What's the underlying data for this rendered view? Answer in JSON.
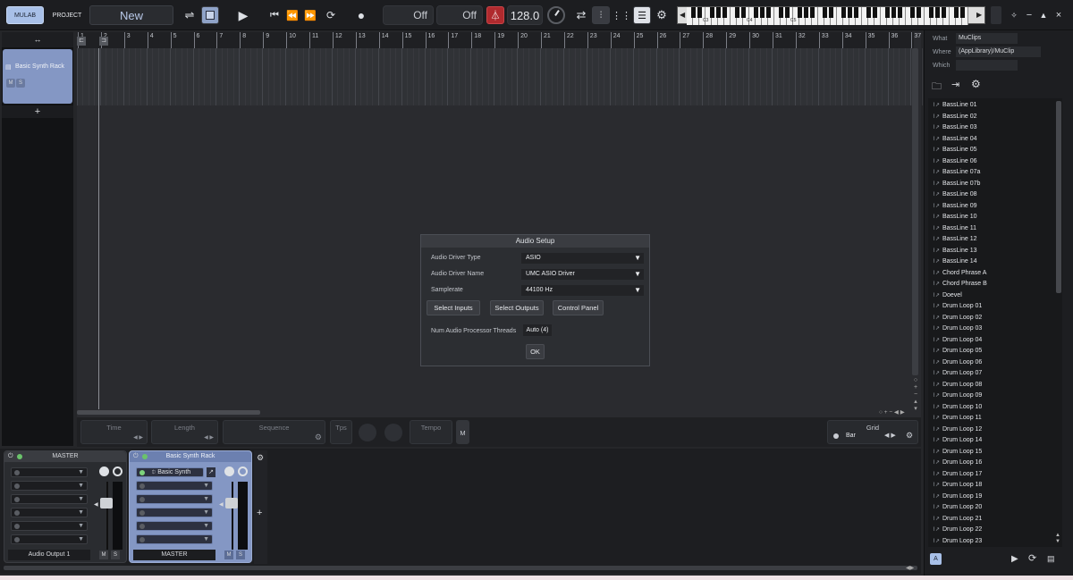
{
  "topbar": {
    "mulab": "MULAB",
    "project": "PROJECT",
    "project_name": "New",
    "sync_off_1": "Off",
    "sync_off_2": "Off",
    "tempo": "128.0"
  },
  "keyboard": {
    "labels": [
      "C3",
      "C4",
      "C5"
    ]
  },
  "tracks": [
    {
      "name": "Basic Synth Rack",
      "mute": "M",
      "solo": "S"
    }
  ],
  "ruler": [
    "1",
    "2",
    "3",
    "4",
    "5",
    "6",
    "7",
    "8",
    "9",
    "10",
    "11",
    "12",
    "13",
    "14",
    "15",
    "16",
    "17",
    "18",
    "19",
    "20",
    "21",
    "22",
    "23",
    "24",
    "25",
    "26",
    "27",
    "28",
    "29",
    "30",
    "31",
    "32",
    "33",
    "34",
    "35",
    "36",
    "37"
  ],
  "add_track": "+",
  "dialog": {
    "title": "Audio Setup",
    "driver_type_label": "Audio Driver Type",
    "driver_type": "ASIO",
    "driver_name_label": "Audio Driver Name",
    "driver_name": "UMC ASIO Driver",
    "samplerate_label": "Samplerate",
    "samplerate": "44100 Hz",
    "select_inputs": "Select Inputs",
    "select_outputs": "Select Outputs",
    "control_panel": "Control Panel",
    "threads_label": "Num Audio Processor Threads",
    "threads": "Auto (4)",
    "ok": "OK"
  },
  "transport_fields": {
    "time": "Time",
    "length": "Length",
    "sequence": "Sequence",
    "tps": "Tps",
    "tempo": "Tempo",
    "m": "M",
    "grid": "Grid",
    "grid_value": "Bar"
  },
  "mixer": {
    "master": {
      "title": "MASTER",
      "output": "Audio Output 1",
      "m": "M",
      "s": "S"
    },
    "rack": {
      "title": "Basic Synth Rack",
      "slot1": "Basic Synth",
      "output": "MASTER",
      "m": "M",
      "s": "S"
    },
    "add": "+"
  },
  "browser": {
    "what_label": "What",
    "what": "MuClips",
    "where_label": "Where",
    "where": "(AppLibrary)/MuClip",
    "which_label": "Which",
    "items": [
      "BassLine 01",
      "BassLine 02",
      "BassLine 03",
      "BassLine 04",
      "BassLine 05",
      "BassLine 06",
      "BassLine 07a",
      "BassLine 07b",
      "BassLine 08",
      "BassLine 09",
      "BassLine 10",
      "BassLine 11",
      "BassLine 12",
      "BassLine 13",
      "BassLine 14",
      "Chord Phrase A",
      "Chord Phrase B",
      "Doevel",
      "Drum Loop 01",
      "Drum Loop 02",
      "Drum Loop 03",
      "Drum Loop 04",
      "Drum Loop 05",
      "Drum Loop 06",
      "Drum Loop 07",
      "Drum Loop 08",
      "Drum Loop 09",
      "Drum Loop 10",
      "Drum Loop 11",
      "Drum Loop 12",
      "Drum Loop 14",
      "Drum Loop 15",
      "Drum Loop 16",
      "Drum Loop 17",
      "Drum Loop 18",
      "Drum Loop 19",
      "Drum Loop 20",
      "Drum Loop 21",
      "Drum Loop 22",
      "Drum Loop 23"
    ],
    "footer_a": "A"
  },
  "colors": {
    "accent": "#6b82b8",
    "record": "#c0282c",
    "background": "#252629"
  }
}
